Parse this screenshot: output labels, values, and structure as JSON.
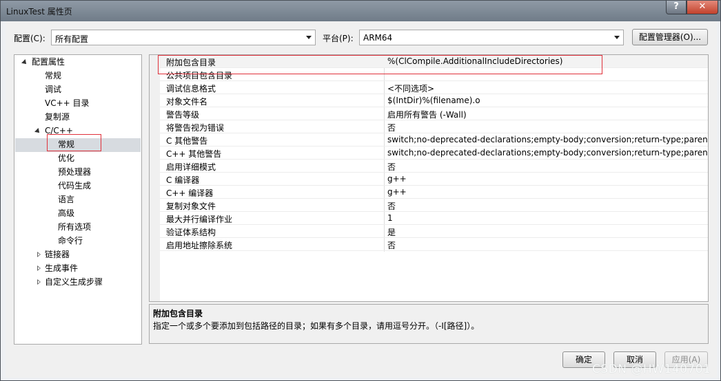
{
  "window": {
    "title": "LinuxTest 属性页"
  },
  "titlebar": {
    "help_label": "?",
    "close_label": "✕"
  },
  "header": {
    "config_label": "配置(C):",
    "config_value": "所有配置",
    "platform_label": "平台(P):",
    "platform_value": "ARM64",
    "config_manager_label": "配置管理器(O)..."
  },
  "tree": {
    "items": [
      {
        "label": "配置属性",
        "expander": "open"
      },
      {
        "label": "常规"
      },
      {
        "label": "调试"
      },
      {
        "label": "VC++ 目录"
      },
      {
        "label": "复制源"
      },
      {
        "label": "C/C++",
        "expander": "open"
      },
      {
        "label": "常规",
        "selected": true
      },
      {
        "label": "优化"
      },
      {
        "label": "预处理器"
      },
      {
        "label": "代码生成"
      },
      {
        "label": "语言"
      },
      {
        "label": "高级"
      },
      {
        "label": "所有选项"
      },
      {
        "label": "命令行"
      },
      {
        "label": "链接器",
        "expander": "closed"
      },
      {
        "label": "生成事件",
        "expander": "closed"
      },
      {
        "label": "自定义生成步骤",
        "expander": "closed"
      }
    ]
  },
  "grid": {
    "rows": [
      {
        "name": "附加包含目录",
        "value": "%(ClCompile.AdditionalIncludeDirectories)"
      },
      {
        "name": "公共项目包含目录",
        "value": ""
      },
      {
        "name": "调试信息格式",
        "value": "<不同选项>"
      },
      {
        "name": "对象文件名",
        "value": "$(IntDir)%(filename).o"
      },
      {
        "name": "警告等级",
        "value": "启用所有警告 (-Wall)"
      },
      {
        "name": "将警告视为错误",
        "value": "否"
      },
      {
        "name": "C 其他警告",
        "value": "switch;no-deprecated-declarations;empty-body;conversion;return-type;parenthes"
      },
      {
        "name": "C++ 其他警告",
        "value": "switch;no-deprecated-declarations;empty-body;conversion;return-type;parenthes"
      },
      {
        "name": "启用详细模式",
        "value": "否"
      },
      {
        "name": "C 编译器",
        "value": "g++"
      },
      {
        "name": "C++ 编译器",
        "value": "g++"
      },
      {
        "name": "复制对象文件",
        "value": "否"
      },
      {
        "name": "最大并行编译作业",
        "value": "1"
      },
      {
        "name": "验证体系结构",
        "value": "是"
      },
      {
        "name": "启用地址擦除系统",
        "value": "否"
      }
    ]
  },
  "description": {
    "title": "附加包含目录",
    "text": "指定一个或多个要添加到包括路径的目录；如果有多个目录，请用逗号分开。（-I[路径]）。"
  },
  "footer": {
    "ok_label": "确定",
    "cancel_label": "取消",
    "apply_label": "应用(A)"
  },
  "watermark": "CSDN @HW140701",
  "colors": {
    "highlight_box": "#e0303a",
    "selected_tree_item": "#d7dbe0"
  }
}
